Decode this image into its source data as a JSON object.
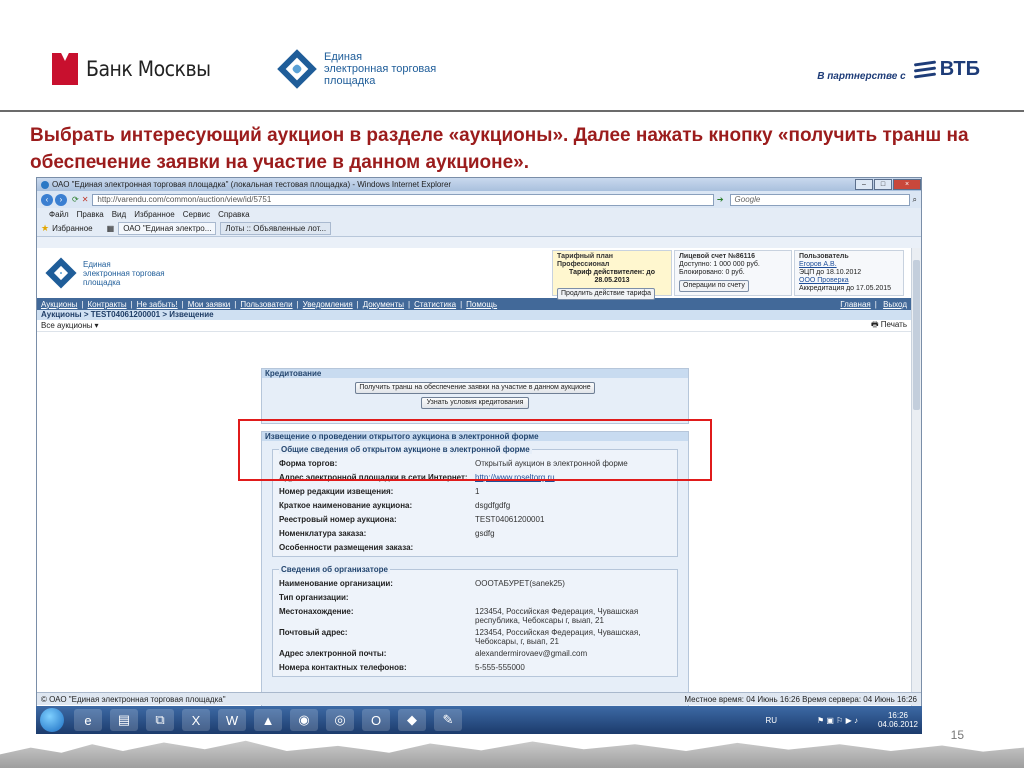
{
  "slide": {
    "bank_moscow": "Банк Москвы",
    "etp_logo_text": "Единая\nэлектронная торговая\nплощадка",
    "partner_text": "В партнерстве с",
    "vtb": "ВТБ",
    "instruction": "Выбрать интересующий аукцион в разделе «аукционы». Далее нажать кнопку «получить транш на обеспечение заявки на участие в данном аукционе».",
    "page_number": "15"
  },
  "browser": {
    "title": "ОАО \"Единая электронная торговая площадка\" (локальная тестовая площадка) - Windows Internet Explorer",
    "url": "http://varendu.com/common/auction/view/id/5751",
    "search_placeholder": "Google",
    "menu": [
      "Файл",
      "Правка",
      "Вид",
      "Избранное",
      "Сервис",
      "Справка"
    ],
    "favorites_label": "Избранное",
    "tabs": [
      "ОАО \"Единая электро...",
      "Лоты :: Объявленные лот..."
    ],
    "status_left": "© ОАО \"Единая электронная торговая площадка\"",
    "status_right": "Местное время: 04 Июнь 16:26 Время сервера: 04 Июнь 16:26"
  },
  "site": {
    "logo_text": "Единая\nэлектронная торговая\nплощадка",
    "tariff": {
      "heading": "Тарифный план Профессионал",
      "valid": "Тариф действителен: до 28.05.2013",
      "button": "Продлить действие тарифа"
    },
    "account": {
      "heading": "Лицевой счет №86116",
      "available": "Доступно: 1 000 000 руб.",
      "blocked": "Блокировано: 0 руб.",
      "button": "Операции по счету"
    },
    "user": {
      "heading": "Пользователь",
      "name": "Егоров А.В.",
      "ecp": "ЭЦП до 18.10.2012",
      "org": "ООО Проверка",
      "accr": "Аккредитация до 17.05.2015"
    },
    "nav": [
      "Аукционы",
      "Контракты",
      "Не забыть!",
      "Мои заявки",
      "Пользователи",
      "Уведомления",
      "Документы",
      "Статистика",
      "Помощь"
    ],
    "nav_right": [
      "Главная",
      "Выход"
    ],
    "breadcrumb": "Аукционы > TEST04061200001 > Извещение",
    "all_auctions": "Все аукционы",
    "print": "Печать"
  },
  "credit": {
    "heading": "Кредитование",
    "btn_get": "Получить транш на обеспечение заявки на участие в данном аукционе",
    "btn_terms": "Узнать условия кредитования"
  },
  "notice": {
    "heading": "Извещение о проведении открытого аукциона в электронной форме",
    "general_legend": "Общие сведения об открытом аукционе в электронной форме",
    "general": [
      {
        "k": "Форма торгов:",
        "v": "Открытый аукцион в электронной форме"
      },
      {
        "k": "Адрес электронной площадки в сети Интернет:",
        "v": "http://www.roseltorg.ru"
      },
      {
        "k": "Номер редакции извещения:",
        "v": "1"
      },
      {
        "k": "Краткое наименование аукциона:",
        "v": "dsgdfgdfg"
      },
      {
        "k": "Реестровый номер аукциона:",
        "v": "TEST04061200001"
      },
      {
        "k": "Номенклатура заказа:",
        "v": "gsdfg"
      },
      {
        "k": "Особенности размещения заказа:",
        "v": ""
      }
    ],
    "org_legend": "Сведения об организаторе",
    "org": [
      {
        "k": "Наименование организации:",
        "v": "ОООТАБУРЕТ(sanek25)"
      },
      {
        "k": "Тип организации:",
        "v": ""
      },
      {
        "k": "Местонахождение:",
        "v": "123454, Российская Федерация, Чувашская республика, Чебоксары г, выап, 21"
      },
      {
        "k": "Почтовый адрес:",
        "v": "123454, Российская Федерация, Чувашская, Чебоксары, г, выап, 21"
      },
      {
        "k": "Адрес электронной почты:",
        "v": "alexandermirovaev@gmail.com"
      },
      {
        "k": "Номера контактных телефонов:",
        "v": "5-555-555000"
      }
    ]
  },
  "tray": {
    "lang": "RU",
    "time": "16:26",
    "date": "04.06.2012"
  }
}
